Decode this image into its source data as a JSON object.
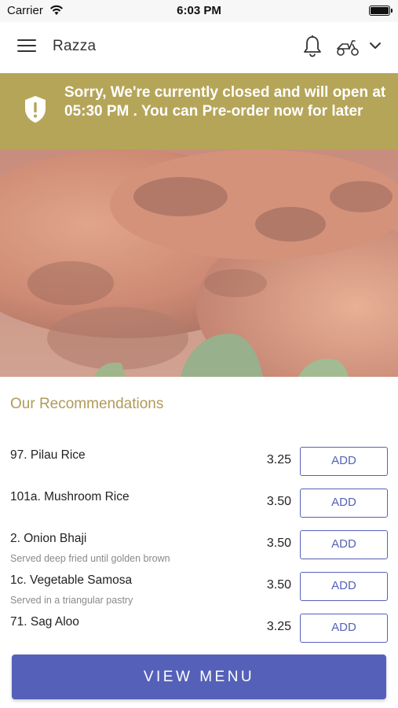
{
  "status_bar": {
    "carrier": "Carrier",
    "time": "6:03 PM",
    "wifi_icon": "wifi-icon",
    "battery_icon": "battery-icon"
  },
  "app_bar": {
    "title": "Razza",
    "menu_icon": "hamburger-menu-icon",
    "notification_icon": "bell-icon",
    "delivery_icon": "scooter-icon",
    "dropdown_icon": "chevron-down-icon"
  },
  "closed_banner": {
    "icon": "shield-exclamation-icon",
    "message": "Sorry, We're currently closed and will open at 05:30 PM . You can Pre-order now for later",
    "background_color": "#b5a559"
  },
  "hero": {
    "image": "tandoori-chicken-photo"
  },
  "recommendations": {
    "title": "Our Recommendations",
    "items": [
      {
        "name": "97. Pilau Rice",
        "description": "",
        "price": "3.25",
        "button": "ADD"
      },
      {
        "name": "101a. Mushroom Rice",
        "description": "",
        "price": "3.50",
        "button": "ADD"
      },
      {
        "name": "2. Onion Bhaji",
        "description": "Served deep fried until golden brown",
        "price": "3.50",
        "button": "ADD"
      },
      {
        "name": "1c. Vegetable Samosa",
        "description": "Served in a triangular pastry",
        "price": "3.50",
        "button": "ADD"
      },
      {
        "name": "71. Sag Aloo",
        "description": "",
        "price": "3.25",
        "button": "ADD"
      }
    ]
  },
  "footer": {
    "view_menu_label": "VIEW MENU"
  },
  "colors": {
    "accent": "#5561b8",
    "section_title": "#b09a5a",
    "banner": "#b5a559"
  }
}
